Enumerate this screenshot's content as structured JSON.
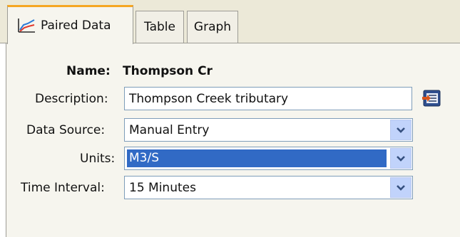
{
  "tabs": [
    {
      "label": "Paired Data",
      "icon": "line-chart-icon",
      "active": true
    },
    {
      "label": "Table",
      "active": false
    },
    {
      "label": "Graph",
      "active": false
    }
  ],
  "form": {
    "name_label": "Name:",
    "name_value": "Thompson Cr",
    "description_label": "Description:",
    "description_value": "Thompson Creek tributary",
    "data_source_label": "Data Source:",
    "data_source_value": "Manual Entry",
    "units_label": "Units:",
    "units_value": "M3/S",
    "time_interval_label": "Time Interval:",
    "time_interval_value": "15 Minutes"
  },
  "colors": {
    "tab_accent": "#f5a623",
    "selection": "#316ac5",
    "dropdown_button": "#c1d3fb"
  }
}
